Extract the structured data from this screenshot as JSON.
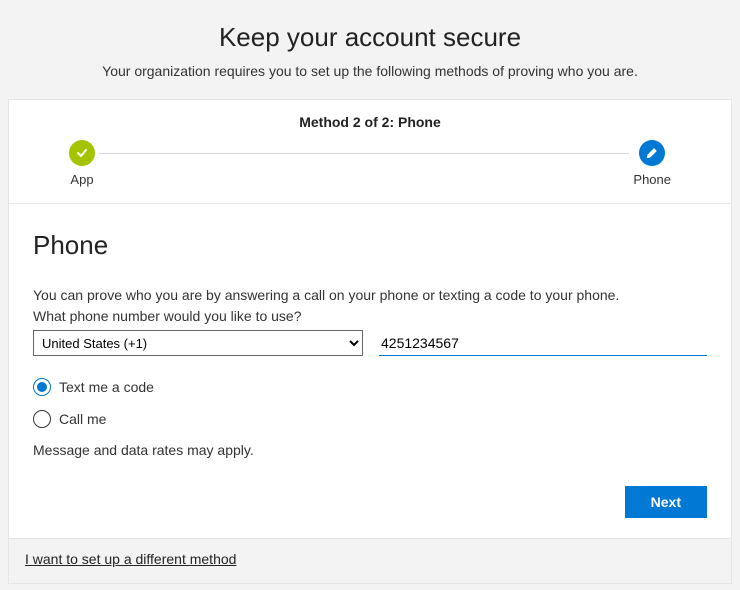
{
  "header": {
    "title": "Keep your account secure",
    "subtitle": "Your organization requires you to set up the following methods of proving who you are."
  },
  "stepper": {
    "title": "Method 2 of 2: Phone",
    "steps": [
      {
        "label": "App",
        "state": "done"
      },
      {
        "label": "Phone",
        "state": "current"
      }
    ]
  },
  "section": {
    "heading": "Phone",
    "description": "You can prove who you are by answering a call on your phone or texting a code to your phone.",
    "prompt": "What phone number would you like to use?",
    "country": {
      "selected": "United States (+1)",
      "options": [
        "United States (+1)"
      ]
    },
    "phone_value": "4251234567",
    "radios": {
      "text_label": "Text me a code",
      "call_label": "Call me",
      "selected": "text"
    },
    "rates_note": "Message and data rates may apply.",
    "next_label": "Next"
  },
  "footer": {
    "alt_method_label": "I want to set up a different method"
  }
}
